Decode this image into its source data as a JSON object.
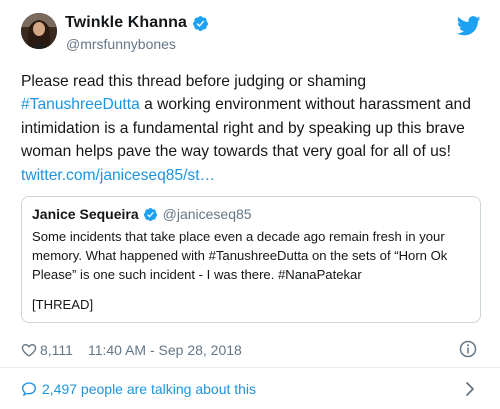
{
  "author": {
    "name": "Twinkle Khanna",
    "handle": "@mrsfunnybones",
    "verified": true
  },
  "tweet": {
    "text_part1": "Please read this thread before judging or shaming ",
    "hashtag": "#TanushreeDutta",
    "text_part2": " a working environment without harassment and intimidation is a fundamental right and by speaking up this brave woman helps pave the way towards that very goal for all of us! ",
    "link": "twitter.com/janiceseq85/st…"
  },
  "quoted_tweet": {
    "name": "Janice Sequeira",
    "handle": "@janiceseq85",
    "verified": true,
    "text": "Some incidents that take place even a decade ago remain fresh in your memory. What happened with #TanushreeDutta on the sets of “Horn Ok Please” is one such incident - I was there. #NanaPatekar",
    "thread_label": "[THREAD]"
  },
  "meta": {
    "likes": "8,111",
    "timestamp": "11:40 AM - Sep 28, 2018"
  },
  "conversation": {
    "label": "2,497 people are talking about this"
  },
  "colors": {
    "accent": "#1b95e0",
    "text": "#14171a",
    "muted": "#657786",
    "border": "#ccd6dd",
    "twitter_blue": "#1da1f2"
  },
  "icons": [
    "avatar",
    "verified-badge-icon",
    "twitter-bird-icon",
    "heart-icon",
    "info-icon",
    "comment-bubble-icon",
    "chevron-right-icon"
  ]
}
